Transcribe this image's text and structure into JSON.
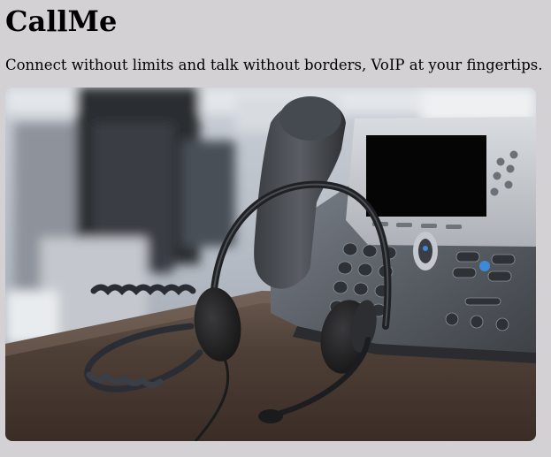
{
  "app": {
    "title": "CallMe",
    "tagline": "Connect without limits and talk without borders, VoIP at your fingertips."
  },
  "hero_image": {
    "subject": "voip-desk-phone-with-headset-photo"
  },
  "colors": {
    "page_background": "#d3d1d3",
    "text": "#000000"
  }
}
